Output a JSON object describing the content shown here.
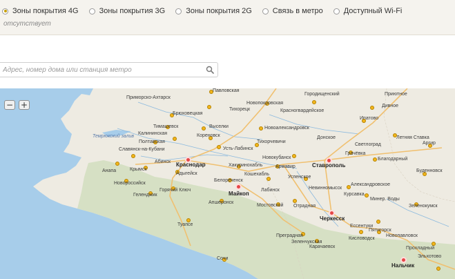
{
  "coverage_options": [
    {
      "label": "Зоны покрытия 4G",
      "selected": true
    },
    {
      "label": "Зоны покрытия 3G",
      "selected": false
    },
    {
      "label": "Зоны покрытия 2G",
      "selected": false
    },
    {
      "label": "Связь в метро",
      "selected": false
    },
    {
      "label": "Доступный Wi-Fi",
      "selected": false
    }
  ],
  "status_text": "отсутствует",
  "search": {
    "placeholder": "Адрес, номер дома или станция метро",
    "value": ""
  },
  "map": {
    "zoom_out": "−",
    "zoom_in": "+",
    "labels": {
      "pavlovskaya": "Павловская",
      "gorodishchenskiy": "Городищенский",
      "priyutnoe": "Приютное",
      "primorsko_akhtarsk": "Приморско-Ахтарск",
      "novopokrovskaya": "Новопокровская",
      "tikhoretsk": "Тихорецк",
      "krasnogvardeyskoe": "Красногвардейское",
      "divnoe": "Дивное",
      "bryukhovetskaya": "Брюховецкая",
      "ipatovo": "Ипатово",
      "temryuk_gulf": "Темрюкский залив",
      "timashevsk": "Тимашевск",
      "vyselki": "Выселки",
      "novoaleksandrovsk": "Новоалександровск",
      "kalininskaya": "Калининская",
      "korenovsk": "Кореновск",
      "donskoe": "Донское",
      "letnyaya_stavka": "Летняя Ставка",
      "poltavskaya": "Полтавская",
      "ust_labinsk": "Усть-Лабинск",
      "svetlograd": "Светлоград",
      "argir": "Аргир",
      "slavyansk": "Славянск-на-Кубани",
      "tikhorchevichi": "Тихорчевичи",
      "gracheva": "Грачёвка",
      "krasnodar": "Краснодар",
      "novokubansk": "Новокубанск",
      "stavropol": "Ставрополь",
      "blagodarny": "Благодарный",
      "anapa": "Анапа",
      "krymsk": "Крымск",
      "abinsk": "Абинск",
      "adygeysk": "Адыгейск",
      "khakurinokhabl": "Хакуринохабль",
      "armavir": "Армавир",
      "budennovsk": "Буденновск",
      "novorossiysk": "Новороссийск",
      "belorechensk": "Белореченск",
      "koshekhabl": "Кошехабль",
      "uspenskoe": "Успенское",
      "aleksandrovskoe": "Александровское",
      "gelendzhik": "Геленджик",
      "goryachiy_klyuch": "Горячий Ключ",
      "maykop": "Майкоп",
      "labinsk": "Лабинск",
      "nevinnomyssk": "Невинномысск",
      "kursavka": "Курсавка",
      "mineralnye_vody": "Минер. Воды",
      "apsheronsk": "Апшеронск",
      "mostovskoy": "Мостовской",
      "otradnaya": "Отрадная",
      "zelenokumsk": "Зеленокумск",
      "tuapse": "Туапсе",
      "cherkessk": "Черкесск",
      "pregradnaya": "Преградная",
      "essentuki": "Ессентуки",
      "pyatigorsk": "Пятигорск",
      "zelenchukskaya": "Зеленчукская",
      "kislovodsk": "Кисловодск",
      "novopavlovsk": "Новопавловск",
      "karachaevsk": "Карачаевск",
      "prokhladny": "Прохладный",
      "sochi": "Сочи",
      "nalchik": "Нальчик",
      "elkhotovo": "Эльхотово"
    }
  },
  "colors": {
    "accent": "#c8a000",
    "sea": "#a7cdea",
    "lowland": "#eeebe2",
    "mountains": "#d6e0c4",
    "major_road": "#f0c070",
    "river": "#8bb9de",
    "city_marker": "#f2b51c",
    "capital_marker": "#e64646"
  }
}
